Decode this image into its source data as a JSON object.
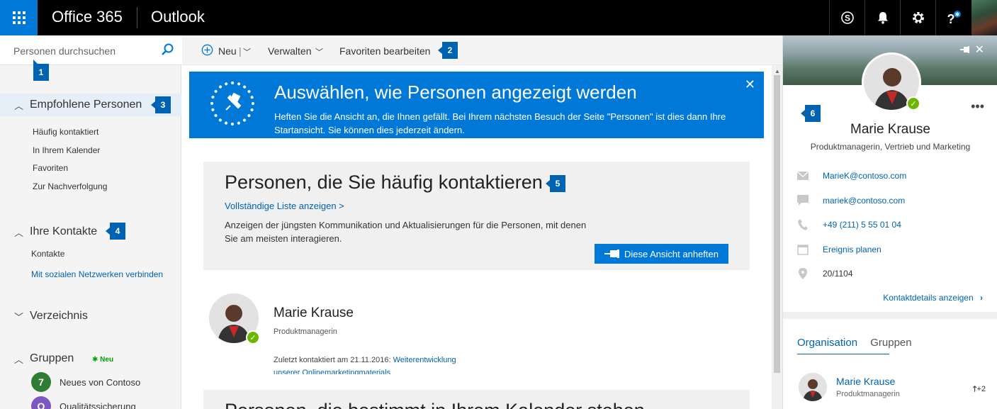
{
  "topbar": {
    "brand": "Office 365",
    "app": "Outlook",
    "icons": [
      "waffle-icon",
      "skype-icon",
      "bell-icon",
      "gear-icon",
      "help-icon",
      "avatar"
    ]
  },
  "search": {
    "placeholder": "Personen durchsuchen"
  },
  "callouts": {
    "c1": "1",
    "c2": "2",
    "c3": "3",
    "c4": "4",
    "c5": "5",
    "c6": "6"
  },
  "nav": {
    "recommended": {
      "label": "Empfohlene Personen",
      "items": [
        "Häufig kontaktiert",
        "In Ihrem Kalender",
        "Favoriten",
        "Zur Nachverfolgung"
      ]
    },
    "contacts": {
      "label": "Ihre Kontakte",
      "items": [
        "Kontakte"
      ],
      "link": "Mit sozialen Netzwerken verbinden"
    },
    "directory": {
      "label": "Verzeichnis"
    },
    "groups": {
      "label": "Gruppen",
      "badge": "Neu",
      "items": [
        "Neues von Contoso",
        "Qualitätssicherung"
      ]
    }
  },
  "commands": {
    "new": "Neu",
    "manage": "Verwalten",
    "edit_favorites": "Favoriten bearbeiten"
  },
  "banner": {
    "title": "Auswählen, wie Personen angezeigt werden",
    "desc": "Heften Sie die Ansicht an, die Ihnen gefällt. Bei Ihrem nächsten Besuch der Seite \"Personen\" ist dies dann Ihre Startansicht. Sie können dies jederzeit ändern."
  },
  "frequent": {
    "title": "Personen, die Sie häufig kontaktieren",
    "link": "Vollständige Liste anzeigen >",
    "desc": "Anzeigen der jüngsten Kommunikation und Aktualisierungen für die Personen, mit denen Sie am meisten interagieren.",
    "pin_button": "Diese Ansicht anheften"
  },
  "person": {
    "name": "Marie Krause",
    "role": "Produktmanagerin",
    "last_contact_prefix": "Zuletzt kontaktiert am 21.11.2016:",
    "last_contact_link": "Weiterentwicklung",
    "last_contact_cont": "unserer Onlinemarketingmaterials"
  },
  "calendar_section": {
    "title": "Personen, die bestimmt in Ihrem Kalender stehen"
  },
  "contact_card": {
    "name": "Marie Krause",
    "role": "Produktmanagerin, Vertrieb und Marketing",
    "email": "MarieK@contoso.com",
    "im": "mariek@contoso.com",
    "phone": "+49 (211) 5 55 01 04",
    "schedule": "Ereignis planen",
    "office": "20/1104",
    "details_link": "Kontaktdetails anzeigen",
    "tabs": [
      "Organisation",
      "Gruppen"
    ],
    "org_person": {
      "name": "Marie Krause",
      "role": "Produktmanagerin",
      "count": "+2"
    }
  },
  "colors": {
    "accent": "#0078d7",
    "link": "#0063b1",
    "presence": "#6bb700"
  }
}
